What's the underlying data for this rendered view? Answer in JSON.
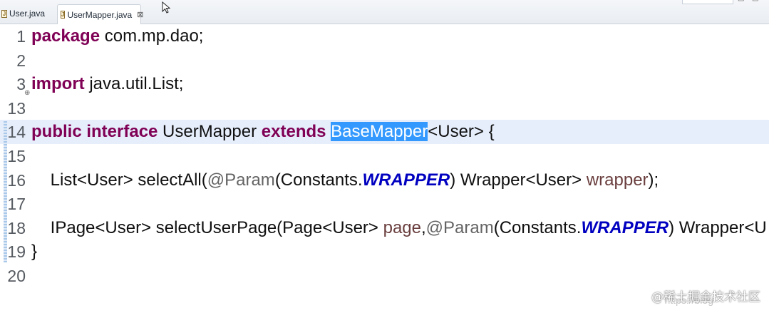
{
  "tabs": [
    {
      "label": "User.java",
      "active": false,
      "icon": "java-file-icon"
    },
    {
      "label": "UserMapper.java",
      "active": true,
      "icon": "java-file-icon",
      "close": "⊠"
    }
  ],
  "editor": {
    "lines": [
      {
        "num": "1",
        "tokens": [
          {
            "t": "package",
            "c": "kw"
          },
          {
            "t": " com.mp.dao;",
            "c": ""
          }
        ]
      },
      {
        "num": "2",
        "tokens": []
      },
      {
        "num": "3",
        "fold": "⊕",
        "tokens": [
          {
            "t": "import",
            "c": "kw"
          },
          {
            "t": " java.util.List;",
            "c": ""
          }
        ]
      },
      {
        "num": "13",
        "tokens": []
      },
      {
        "num": "14",
        "current": true,
        "tokens": [
          {
            "t": "public",
            "c": "kw"
          },
          {
            "t": " ",
            "c": ""
          },
          {
            "t": "interface",
            "c": "kw"
          },
          {
            "t": " UserMapper ",
            "c": ""
          },
          {
            "t": "extends",
            "c": "kw"
          },
          {
            "t": " ",
            "c": ""
          },
          {
            "t": "BaseMapper",
            "c": "sel"
          },
          {
            "t": "<User> {",
            "c": ""
          }
        ]
      },
      {
        "num": "15",
        "tokens": []
      },
      {
        "num": "16",
        "tokens": [
          {
            "t": "    List<User> selectAll(",
            "c": ""
          },
          {
            "t": "@Param",
            "c": "ann"
          },
          {
            "t": "(Constants.",
            "c": ""
          },
          {
            "t": "WRAPPER",
            "c": "const"
          },
          {
            "t": ") Wrapper<User> ",
            "c": ""
          },
          {
            "t": "wrapper",
            "c": "param"
          },
          {
            "t": ");",
            "c": ""
          }
        ]
      },
      {
        "num": "17",
        "tokens": []
      },
      {
        "num": "18",
        "tokens": [
          {
            "t": "    IPage<User> selectUserPage(Page<User> ",
            "c": ""
          },
          {
            "t": "page",
            "c": "param"
          },
          {
            "t": ",",
            "c": ""
          },
          {
            "t": "@Param",
            "c": "ann"
          },
          {
            "t": "(Constants.",
            "c": ""
          },
          {
            "t": "WRAPPER",
            "c": "const"
          },
          {
            "t": ") Wrapper<U",
            "c": ""
          }
        ]
      },
      {
        "num": "19",
        "tokens": [
          {
            "t": "}",
            "c": ""
          }
        ]
      },
      {
        "num": "20",
        "tokens": []
      }
    ]
  },
  "watermark": {
    "text": "@稀土掘金技术社区",
    "url": "https://blog"
  },
  "colors": {
    "keyword": "#7f0055",
    "annotation": "#646464",
    "constant": "#0000c0",
    "parameter": "#6a3e3e",
    "selection": "#3399ff",
    "current_line": "#e6eefb"
  }
}
